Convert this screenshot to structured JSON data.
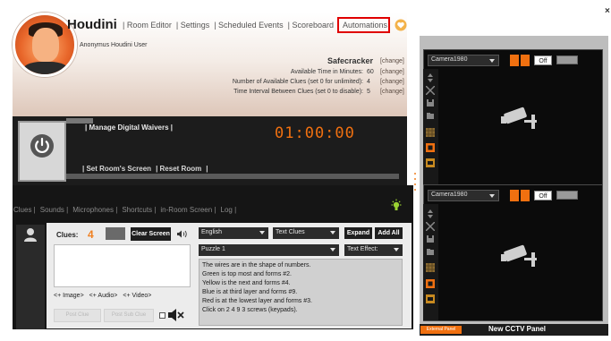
{
  "header": {
    "app_name": "Houdini",
    "nav": [
      "| Room Editor",
      "| Settings",
      "| Scheduled Events",
      "| Scoreboard"
    ],
    "nav_active": "Automations",
    "user": "Anonymus Houdini User"
  },
  "room": {
    "puzzle": "Safecracker",
    "change": "[change]",
    "rows": [
      {
        "label": "Available Time in Minutes:",
        "value": "60"
      },
      {
        "label": "Number of Available Clues (set 0 for unlimited):",
        "value": "4"
      },
      {
        "label": "Time Interval Between Clues (set 0 to disable):",
        "value": "5"
      }
    ]
  },
  "control": {
    "waivers": "| Manage Digital Waivers |",
    "timer": "01:00:00",
    "screen": "| Set Room's Screen",
    "reset": "| Reset Room",
    "end": "|"
  },
  "tabs": [
    "Clues |",
    "Sounds |",
    "Microphones |",
    "Shortcuts |",
    "in-Room Screen |",
    "Log |"
  ],
  "clues": {
    "label": "Clues:",
    "count": "4",
    "clear": "Clear Screen",
    "media": [
      "<+ Image>",
      "<+ Audio>",
      "<+ Video>"
    ],
    "post_clue": "Post Clue",
    "post_sub": "Post Sub Clue",
    "language": "English",
    "type": "Text Clues",
    "expand": "Expand",
    "add_all": "Add All",
    "puzzle_select": "Puzzle 1",
    "effect": "Text Effect:",
    "clue_lines": [
      "The wires are in the shape of numbers.",
      "Green is top most and forms #2.",
      "Yellow is the next and forms #4.",
      "Blue is at third layer and forms #9.",
      "Red is at the lowest layer and forms #3.",
      "Click on 2 4 9 3 screws (keypads)."
    ]
  },
  "cctv": {
    "cameras": [
      {
        "name": "Camera1980",
        "off": "Off"
      },
      {
        "name": "Camera1980",
        "off": "Off"
      }
    ],
    "footer_external": "External Panel",
    "footer_new": "New CCTV Panel"
  },
  "colors": {
    "accent": "#f07010",
    "active_outline": "#e00000"
  }
}
